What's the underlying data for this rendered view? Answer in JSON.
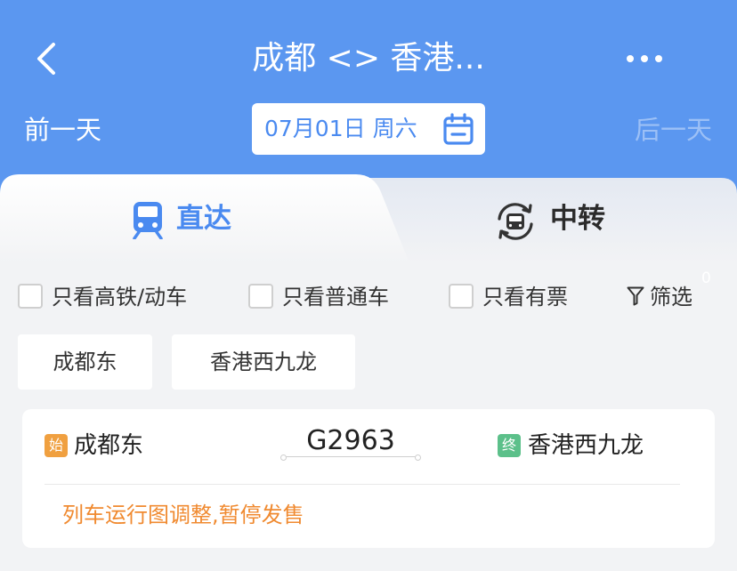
{
  "header": {
    "title": "成都 <> 香港...",
    "prev_day": "前一天",
    "next_day": "后一天",
    "date": "07月01日 周六",
    "icons": [
      "back-icon",
      "more-icon",
      "calendar-icon"
    ]
  },
  "tabs": [
    {
      "label": "直达",
      "icon": "train-icon",
      "active": true
    },
    {
      "label": "中转",
      "icon": "transfer-icon",
      "active": false
    }
  ],
  "filters": {
    "options": [
      "只看高铁/动车",
      "只看普通车",
      "只看有票"
    ],
    "filter_label": "筛选",
    "filter_count": "0"
  },
  "stations": [
    "成都东",
    "香港西九龙"
  ],
  "train": {
    "start_tag": "始",
    "from": "成都东",
    "number": "G2963",
    "end_tag": "终",
    "to": "香港西九龙",
    "notice": "列车运行图调整,暂停发售"
  },
  "colors": {
    "header_bg": "#5b97f0",
    "accent": "#4a8af0",
    "notice": "#f08a30",
    "start_tag": "#f0a040",
    "end_tag": "#5cc08a"
  }
}
